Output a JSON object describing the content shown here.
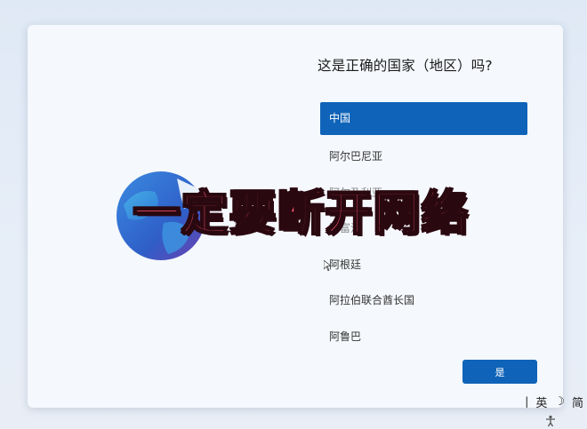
{
  "dialog": {
    "title": "这是正确的国家（地区）吗?",
    "countries": [
      "中国",
      "阿尔巴尼亚",
      "阿尔及利亚",
      "阿富汗",
      "阿根廷",
      "阿拉伯联合酋长国",
      "阿鲁巴"
    ],
    "selected": "中国",
    "yes_label": "是"
  },
  "overlay": {
    "text": "一定要断开网络"
  },
  "tray": {
    "ime_lang": "英",
    "ime_mode": "简"
  },
  "colors": {
    "accent": "#0f63b8",
    "overlay_text": "#ff5a6e"
  }
}
